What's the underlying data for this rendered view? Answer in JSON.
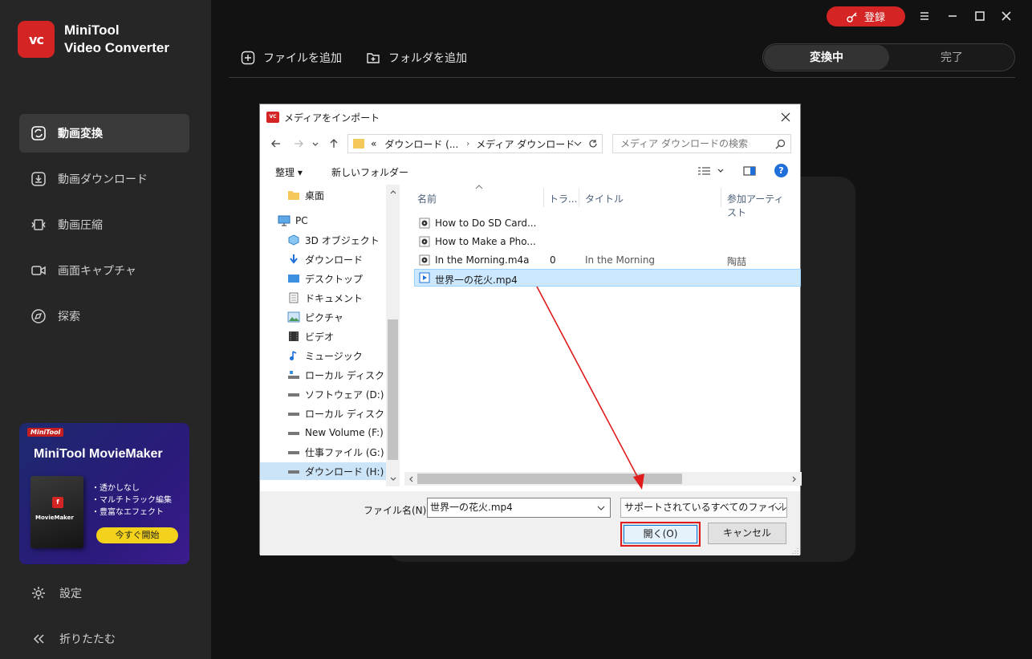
{
  "app": {
    "brand_line1": "MiniTool",
    "brand_line2": "Video Converter",
    "logo_text": "vc",
    "accent_color": "#d42424",
    "login_label": "登録",
    "nav": [
      {
        "label": "動画変換",
        "icon": "convert-icon",
        "active": true
      },
      {
        "label": "動画ダウンロード",
        "icon": "download-icon",
        "active": false
      },
      {
        "label": "動画圧縮",
        "icon": "compress-icon",
        "active": false
      },
      {
        "label": "画面キャプチャ",
        "icon": "camera-icon",
        "active": false
      },
      {
        "label": "探索",
        "icon": "compass-icon",
        "active": false
      }
    ],
    "promo": {
      "tag": "MiniTool",
      "title": "MiniTool MovieMaker",
      "box_logo": "f",
      "box_name": "MovieMaker",
      "features": [
        "・透かしなし",
        "・マルチトラック編集",
        "・豊富なエフェクト"
      ],
      "button": "今すぐ開始"
    },
    "settings_label": "設定",
    "collapse_label": "折りたたむ",
    "add_file_label": "ファイルを追加",
    "add_folder_label": "フォルダを追加",
    "tab_converting": "変換中",
    "tab_done": "完了"
  },
  "dialog": {
    "title": "メディアをインポート",
    "icon_text": "VC",
    "address": {
      "prefix": "«",
      "part1": "ダウンロード (...",
      "sep": "›",
      "part2": "メディア ダウンロード"
    },
    "search_placeholder": "メディア ダウンロードの検索",
    "organize_label": "整理 ▾",
    "new_folder_label": "新しいフォルダー",
    "help_label": "?",
    "tree": [
      {
        "label": "桌面",
        "icon": "folder-icon"
      },
      {
        "label": "PC",
        "icon": "computer-icon"
      },
      {
        "label": "3D オブジェクト",
        "icon": "cube-icon"
      },
      {
        "label": "ダウンロード",
        "icon": "download-arrow-icon"
      },
      {
        "label": "デスクトップ",
        "icon": "desktop-icon"
      },
      {
        "label": "ドキュメント",
        "icon": "document-icon"
      },
      {
        "label": "ピクチャ",
        "icon": "picture-icon"
      },
      {
        "label": "ビデオ",
        "icon": "video-icon"
      },
      {
        "label": "ミュージック",
        "icon": "music-icon"
      },
      {
        "label": "ローカル ディスク (C:)",
        "icon": "drive-icon"
      },
      {
        "label": "ソフトウェア (D:)",
        "icon": "drive-icon"
      },
      {
        "label": "ローカル ディスク (E:)",
        "icon": "drive-icon"
      },
      {
        "label": "New Volume (F:)",
        "icon": "drive-icon"
      },
      {
        "label": "仕事ファイル (G:)",
        "icon": "drive-icon"
      },
      {
        "label": "ダウンロード (H:)",
        "icon": "drive-icon",
        "selected": true
      }
    ],
    "columns": [
      "名前",
      "トラ...",
      "タイトル",
      "参加アーティスト"
    ],
    "files": [
      {
        "name": "How to Do SD Card...",
        "track": "",
        "title": "",
        "artist": "",
        "icon": "media-file-icon"
      },
      {
        "name": "How to Make a Pho...",
        "track": "",
        "title": "",
        "artist": "",
        "icon": "media-file-icon"
      },
      {
        "name": "In the Morning.m4a",
        "track": "0",
        "title": "In the Morning",
        "artist": "陶喆",
        "icon": "media-file-icon"
      },
      {
        "name": "世界一の花火.mp4",
        "track": "",
        "title": "",
        "artist": "",
        "icon": "video-file-icon",
        "selected": true
      }
    ],
    "filename_label": "ファイル名(N):",
    "filename_value": "世界一の花火.mp4",
    "filetype_value": "サポートされているすべてのファイル (*",
    "open_label": "開く(O)",
    "cancel_label": "キャンセル"
  }
}
